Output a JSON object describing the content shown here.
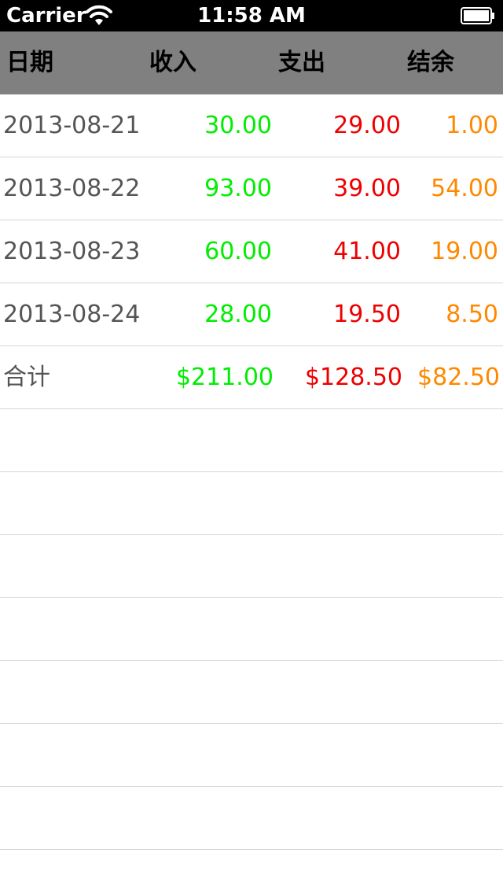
{
  "status_bar": {
    "carrier": "Carrier",
    "time": "11:58 AM",
    "icons": [
      "wifi-icon",
      "battery-icon"
    ]
  },
  "header": {
    "date": "日期",
    "income": "收入",
    "expense": "支出",
    "balance": "结余"
  },
  "rows": [
    {
      "date": "2013-08-21",
      "income": "30.00",
      "expense": "29.00",
      "balance": "1.00"
    },
    {
      "date": "2013-08-22",
      "income": "93.00",
      "expense": "39.00",
      "balance": "54.00"
    },
    {
      "date": "2013-08-23",
      "income": "60.00",
      "expense": "41.00",
      "balance": "19.00"
    },
    {
      "date": "2013-08-24",
      "income": "28.00",
      "expense": "19.50",
      "balance": "8.50"
    }
  ],
  "total": {
    "label": "合计",
    "income": "$211.00",
    "expense": "$128.50",
    "balance": "$82.50"
  },
  "colors": {
    "income": "#00ee00",
    "expense": "#ee0000",
    "balance": "#ff8800",
    "header_bg": "#808080"
  }
}
